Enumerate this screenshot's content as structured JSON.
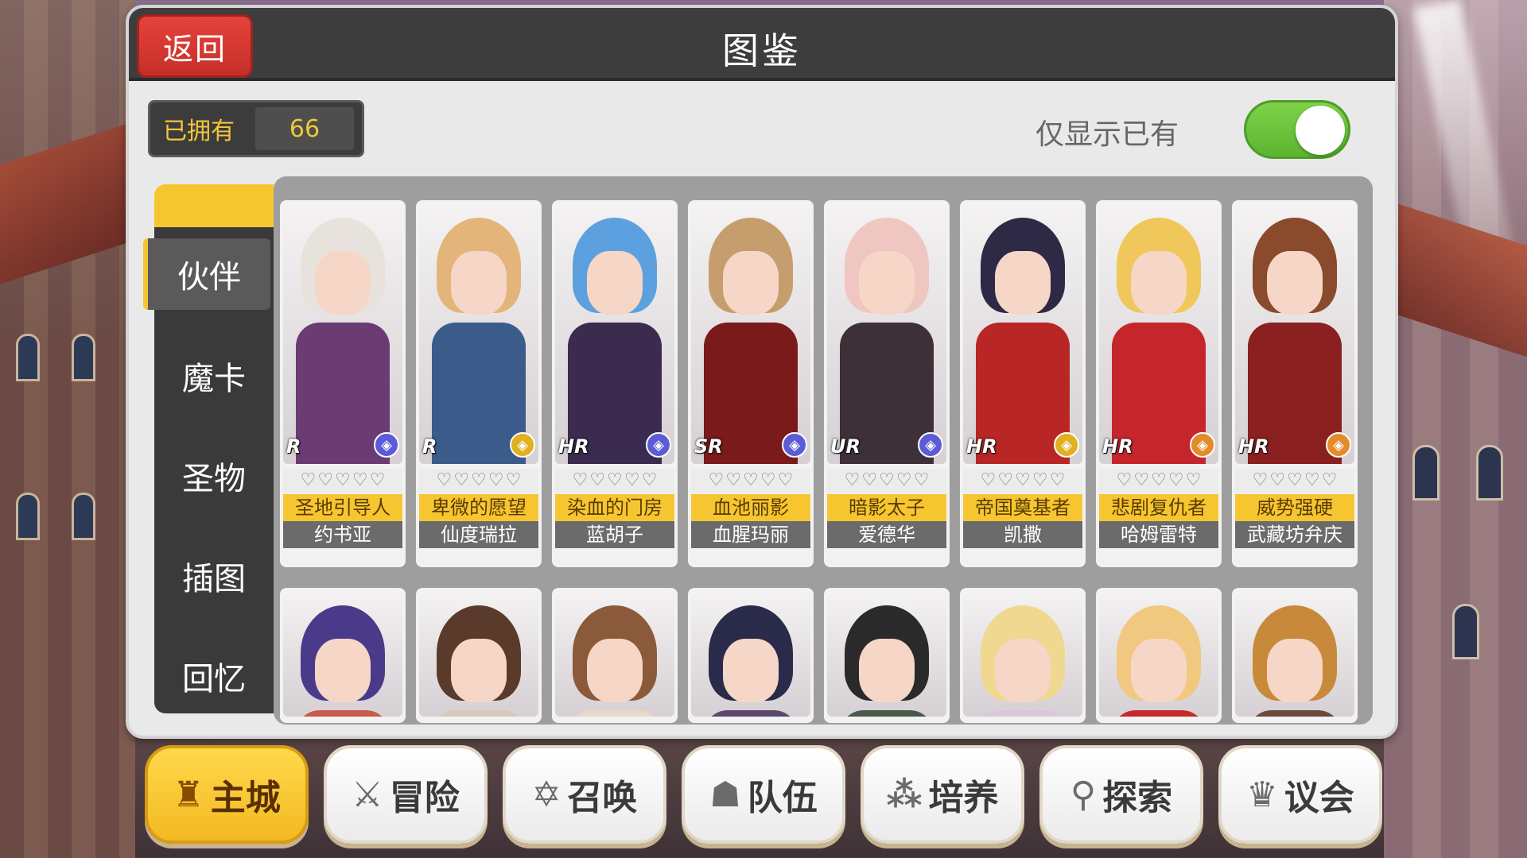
{
  "header": {
    "back_label": "返回",
    "title": "图鉴"
  },
  "owned": {
    "label": "已拥有",
    "count": "66"
  },
  "filter": {
    "label": "仅显示已有",
    "enabled": true
  },
  "sidebar": {
    "items": [
      {
        "label": "伙伴",
        "active": true
      },
      {
        "label": "魔卡",
        "active": false
      },
      {
        "label": "圣物",
        "active": false
      },
      {
        "label": "插图",
        "active": false
      },
      {
        "label": "回忆",
        "active": false
      }
    ]
  },
  "cards_row1": [
    {
      "title": "圣地引导人",
      "name": "约书亚",
      "rarity": "R",
      "element": "wind-icon",
      "hair": "#e8e2dc",
      "body": "#6b3b73",
      "elem_color": "#5b5bd6"
    },
    {
      "title": "卑微的愿望",
      "name": "仙度瑞拉",
      "rarity": "R",
      "element": "light-icon",
      "hair": "#e3b57a",
      "body": "#3b5b8a",
      "elem_color": "#e0b020"
    },
    {
      "title": "染血的门房",
      "name": "蓝胡子",
      "rarity": "HR",
      "element": "wind-icon",
      "hair": "#5da0df",
      "body": "#3a2b4f",
      "elem_color": "#5b5bd6"
    },
    {
      "title": "血池丽影",
      "name": "血腥玛丽",
      "rarity": "SR",
      "element": "wind-icon",
      "hair": "#c69e6e",
      "body": "#7a1a1a",
      "elem_color": "#5b5bd6"
    },
    {
      "title": "暗影太子",
      "name": "爱德华",
      "rarity": "UR",
      "element": "sword-icon",
      "hair": "#f0c6c0",
      "body": "#3d3038",
      "elem_color": "#5b5bd6"
    },
    {
      "title": "帝国奠基者",
      "name": "凯撒",
      "rarity": "HR",
      "element": "light-icon",
      "hair": "#2e2a45",
      "body": "#b82626",
      "elem_color": "#e0b020"
    },
    {
      "title": "悲剧复仇者",
      "name": "哈姆雷特",
      "rarity": "HR",
      "element": "fire-icon",
      "hair": "#f0c75a",
      "body": "#c4262b",
      "elem_color": "#e38a2a"
    },
    {
      "title": "威势强硬",
      "name": "武藏坊弁庆",
      "rarity": "HR",
      "element": "fire-icon",
      "hair": "#8a4a2c",
      "body": "#8b2020",
      "elem_color": "#e38a2a"
    }
  ],
  "cards_row2": [
    {
      "hair": "#4a3a8a",
      "body": "#c75a4a"
    },
    {
      "hair": "#5a3a2a",
      "body": "#d8c8b8"
    },
    {
      "hair": "#8a5a3a",
      "body": "#e8d8c8"
    },
    {
      "hair": "#2a2a4a",
      "body": "#5a4a6a"
    },
    {
      "hair": "#2a2a2a",
      "body": "#4a5a4a"
    },
    {
      "hair": "#f0d890",
      "body": "#d8c8d8"
    },
    {
      "hair": "#f0c880",
      "body": "#c42a2a"
    },
    {
      "hair": "#c88a3a",
      "body": "#6a4a3a"
    }
  ],
  "bottom_nav": [
    {
      "label": "主城",
      "icon": "castle-icon",
      "glyph": "♜",
      "active": true
    },
    {
      "label": "冒险",
      "icon": "crossed-swords-icon",
      "glyph": "⚔",
      "active": false
    },
    {
      "label": "召唤",
      "icon": "hexagram-icon",
      "glyph": "✡",
      "active": false
    },
    {
      "label": "队伍",
      "icon": "team-icon",
      "glyph": "☗",
      "active": false
    },
    {
      "label": "培养",
      "icon": "train-icon",
      "glyph": "⁂",
      "active": false
    },
    {
      "label": "探索",
      "icon": "explore-icon",
      "glyph": "⚲",
      "active": false
    },
    {
      "label": "议会",
      "icon": "council-icon",
      "glyph": "♛",
      "active": false
    }
  ],
  "colors": {
    "accent": "#f6c631",
    "back_button": "#d83a32",
    "toggle_on": "#6cc23a"
  }
}
